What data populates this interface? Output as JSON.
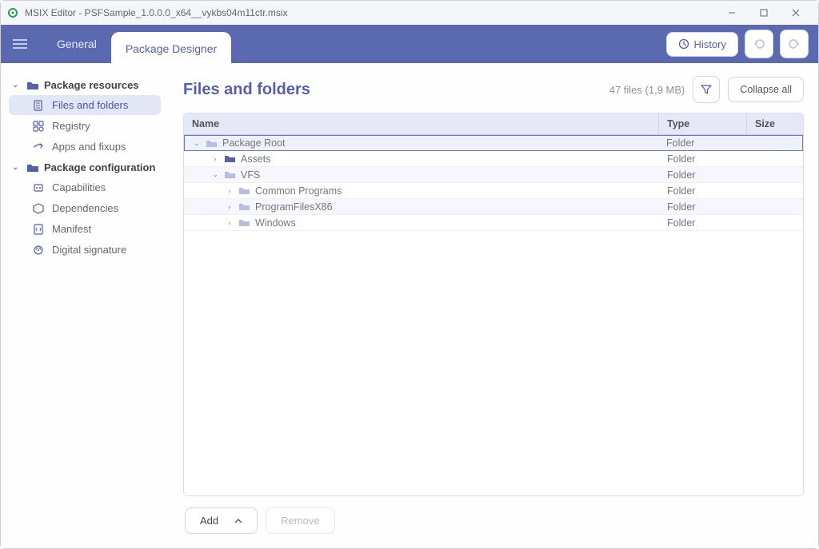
{
  "window": {
    "title": "MSIX Editor - PSFSample_1.0.0.0_x64__vykbs04m11ctr.msix"
  },
  "toolbar": {
    "tab_general": "General",
    "tab_package_designer": "Package Designer",
    "history_label": "History"
  },
  "sidebar": {
    "sections": [
      {
        "label": "Package resources",
        "items": [
          {
            "label": "Files and folders",
            "icon": "files-icon",
            "active": true
          },
          {
            "label": "Registry",
            "icon": "registry-icon"
          },
          {
            "label": "Apps and fixups",
            "icon": "share-icon"
          }
        ]
      },
      {
        "label": "Package configuration",
        "items": [
          {
            "label": "Capabilities",
            "icon": "capabilities-icon"
          },
          {
            "label": "Dependencies",
            "icon": "dependencies-icon"
          },
          {
            "label": "Manifest",
            "icon": "manifest-icon"
          },
          {
            "label": "Digital signature",
            "icon": "signature-icon"
          }
        ]
      }
    ]
  },
  "main": {
    "title": "Files and folders",
    "summary": "47 files (1,9 MB)",
    "collapse_label": "Collapse all",
    "columns": {
      "name": "Name",
      "type": "Type",
      "size": "Size"
    },
    "rows": [
      {
        "name": "Package Root",
        "type": "Folder",
        "indent": 0,
        "expanded": true,
        "selected": true,
        "color": "gray"
      },
      {
        "name": "Assets",
        "type": "Folder",
        "indent": 1,
        "expanded": false,
        "color": "blue"
      },
      {
        "name": "VFS",
        "type": "Folder",
        "indent": 1,
        "expanded": true,
        "color": "gray",
        "alt": true
      },
      {
        "name": "Common Programs",
        "type": "Folder",
        "indent": 2,
        "expanded": false,
        "color": "gray"
      },
      {
        "name": "ProgramFilesX86",
        "type": "Folder",
        "indent": 2,
        "expanded": false,
        "color": "gray",
        "alt": true
      },
      {
        "name": "Windows",
        "type": "Folder",
        "indent": 2,
        "expanded": false,
        "color": "gray"
      }
    ],
    "add_label": "Add",
    "remove_label": "Remove"
  }
}
